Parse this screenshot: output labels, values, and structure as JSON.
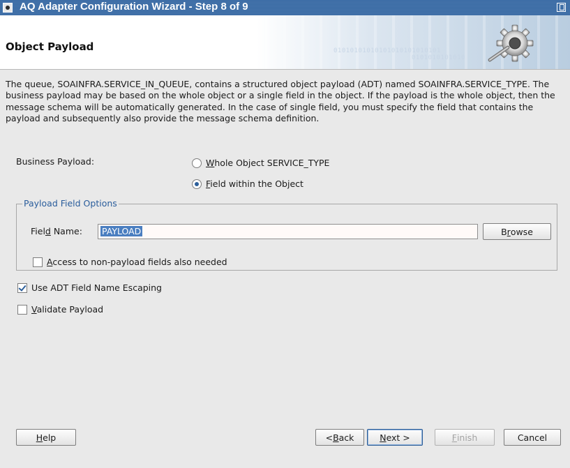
{
  "window": {
    "title": "AQ Adapter Configuration Wizard - Step 8 of 9"
  },
  "header": {
    "heading": "Object Payload",
    "binary_text_1": "01010101010101010101010101",
    "binary_text_2": "0101010101010"
  },
  "description": "The queue, SOAINFRA.SERVICE_IN_QUEUE, contains a structured object payload (ADT) named SOAINFRA.SERVICE_TYPE.  The business payload may be based on the whole object or a single field in the object. If the payload is the whole object, then the message schema will be automatically generated. In the case of single field, you must specify the field that contains the payload and subsequently also provide the message schema definition.",
  "business_payload": {
    "label": "Business Payload:",
    "options": [
      {
        "label": "Whole Object SERVICE_TYPE",
        "mnemonic": "W",
        "rest": "hole Object SERVICE_TYPE",
        "selected": false
      },
      {
        "label": "Field within the Object",
        "mnemonic": "F",
        "rest": "ield within the Object",
        "selected": true
      }
    ]
  },
  "payload_field_options": {
    "legend": "Payload Field Options",
    "field_name_label_pre": "Fiel",
    "field_name_label_mn": "d",
    "field_name_label_post": " Name:",
    "field_name_value": "PAYLOAD",
    "browse_pre": "B",
    "browse_mn": "r",
    "browse_post": "owse",
    "access_checkbox_mn": "A",
    "access_checkbox_rest": "ccess to non-payload fields also needed",
    "access_checked": false
  },
  "use_adt_escaping": {
    "label": "Use ADT Field Name Escaping",
    "checked": true
  },
  "validate_payload": {
    "label_mn": "V",
    "label_rest": "alidate Payload",
    "checked": false
  },
  "buttons": {
    "help_mn": "H",
    "help_rest": "elp",
    "back_pre": "< ",
    "back_mn": "B",
    "back_rest": "ack",
    "next_mn": "N",
    "next_rest": "ext >",
    "finish_mn": "F",
    "finish_rest": "inish",
    "cancel": "Cancel"
  },
  "colors": {
    "titlebar": "#3a6ba5",
    "legend_text": "#2a5d9c",
    "selection": "#4a7ec0"
  }
}
